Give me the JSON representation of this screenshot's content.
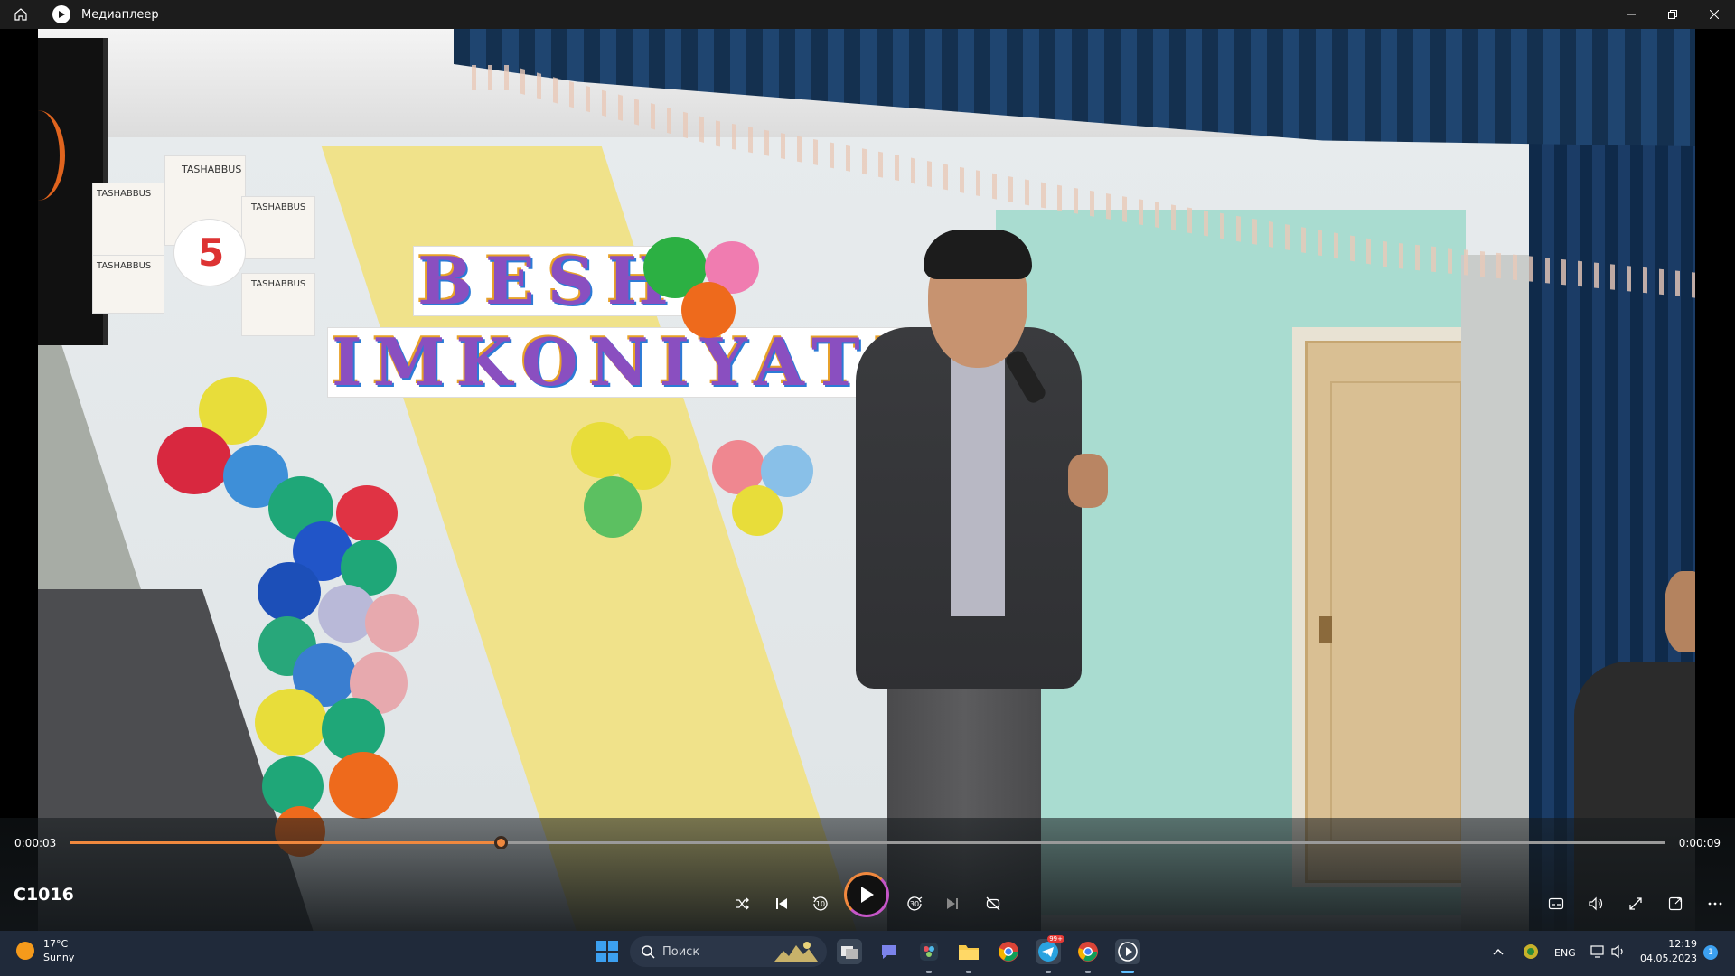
{
  "window": {
    "title": "Медиаплеер"
  },
  "video_scene": {
    "banner_line1": "BESH",
    "banner_line2": "IMKONIYAT\"",
    "poster_labels": [
      "TASHABBUS",
      "TASHABBUS",
      "TASHABBUS",
      "TASHABBUS",
      "TASHABBUS"
    ],
    "poster_number": "5"
  },
  "player": {
    "media_title": "C1016",
    "current_time": "0:00:03",
    "total_time": "0:00:09",
    "progress": 0.27,
    "skip_back_label": "10",
    "skip_forward_label": "30",
    "accent_color": "#f0883e",
    "accent_color_2": "#c656c8"
  },
  "taskbar": {
    "weather_temp": "17°C",
    "weather_desc": "Sunny",
    "search_placeholder": "Поиск",
    "language": "ENG",
    "clock_time": "12:19",
    "clock_date": "04.05.2023",
    "notification_count": "1",
    "telegram_badge": "99+",
    "pinned_apps": [
      "task-view",
      "teams-chat",
      "davinci-resolve",
      "file-explorer",
      "chrome",
      "telegram",
      "chrome",
      "media-player"
    ]
  }
}
